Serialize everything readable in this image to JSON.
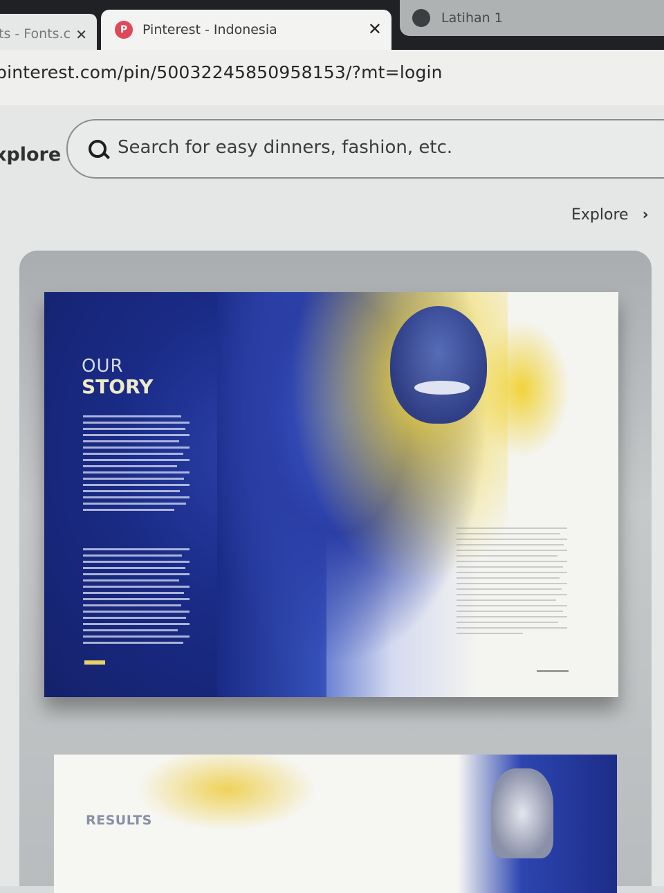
{
  "browser": {
    "tabs": [
      {
        "label": "ts - Fonts.c",
        "close": "✕"
      },
      {
        "label": "Pinterest - Indonesia",
        "close": "✕"
      },
      {
        "label": "Latihan 1"
      }
    ],
    "url": "pinterest.com/pin/500322458509581​53/?mt=login"
  },
  "header": {
    "explore_left": "xplore",
    "search_placeholder": "Search for easy dinners, fashion, etc.",
    "explore_right": "Explore",
    "explore_chevron": "›"
  },
  "pin": {
    "spread1": {
      "heading_top": "OUR",
      "heading_bottom": "STORY"
    },
    "spread2": {
      "heading": "RESULTS"
    }
  },
  "colors": {
    "pinterest_red": "#e0485a",
    "spread_blue": "#1a2b86",
    "accent_yellow": "#f2d63a"
  }
}
